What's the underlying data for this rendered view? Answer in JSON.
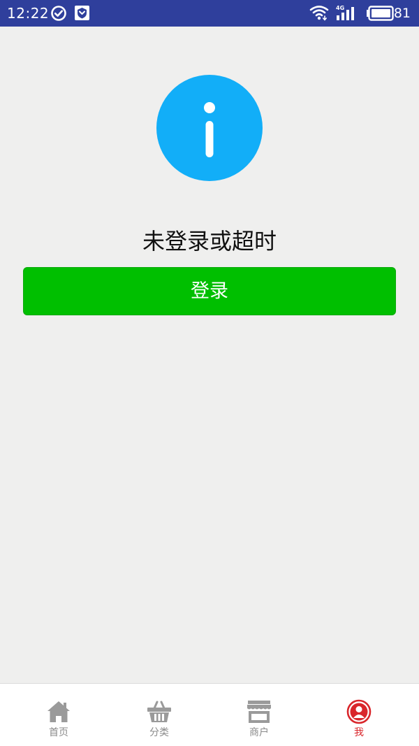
{
  "status_bar": {
    "time": "12:22",
    "network": "4G",
    "battery": "81",
    "background_color": "#2f3f9c",
    "icons": [
      "check-circle-icon",
      "shield-app-icon",
      "wifi-icon",
      "signal-icon",
      "battery-icon"
    ]
  },
  "main": {
    "icon": "info-icon",
    "icon_color": "#12aef8",
    "message": "未登录或超时",
    "login_button_label": "登录",
    "login_button_color": "#00bf00"
  },
  "tab_bar": {
    "active_color": "#d9262b",
    "inactive_color": "#8a8a8a",
    "tabs": [
      {
        "label": "首页",
        "icon": "home-icon",
        "active": false
      },
      {
        "label": "分类",
        "icon": "basket-icon",
        "active": false
      },
      {
        "label": "商户",
        "icon": "store-icon",
        "active": false
      },
      {
        "label": "我",
        "icon": "user-icon",
        "active": true
      }
    ]
  }
}
